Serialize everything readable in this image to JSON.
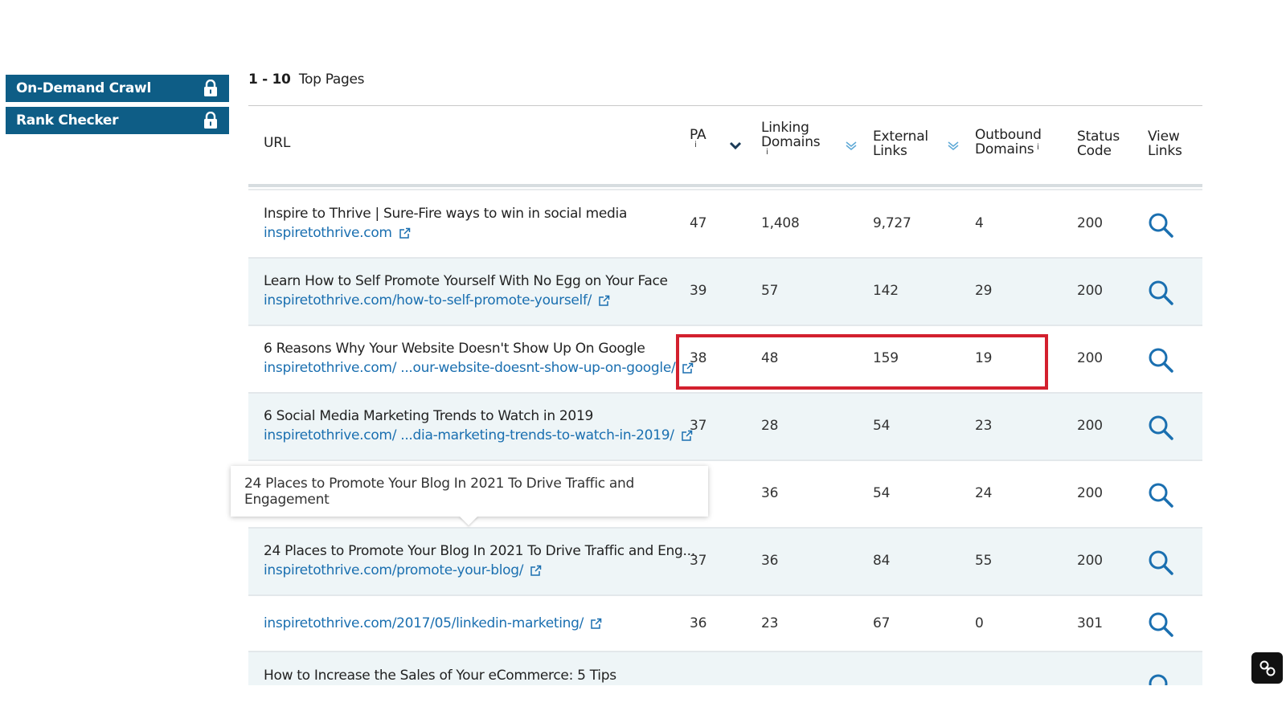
{
  "sidebar": {
    "items": [
      {
        "label": "On-Demand Crawl",
        "icon": "lock-icon"
      },
      {
        "label": "Rank Checker",
        "icon": "lock-icon"
      }
    ]
  },
  "results": {
    "range": "1 - 10",
    "label": "Top Pages"
  },
  "table": {
    "columns": {
      "url": "URL",
      "pa": "PA",
      "pa_info": "i",
      "linking_domains_1": "Linking",
      "linking_domains_2": "Domains",
      "linking_info": "i",
      "external_links_1": "External",
      "external_links_2": "Links",
      "outbound_domains_1": "Outbound",
      "outbound_domains_2": "Domains",
      "outbound_info": "i",
      "status_code_1": "Status",
      "status_code_2": "Code",
      "view_links_1": "View",
      "view_links_2": "Links"
    },
    "rows": [
      {
        "title": "Inspire to Thrive | Sure-Fire ways to win in social media",
        "url": "inspiretothrive.com",
        "pa": "47",
        "ld": "1,408",
        "el": "9,727",
        "od": "4",
        "sc": "200"
      },
      {
        "title": "Learn How to Self Promote Yourself With No Egg on Your Face",
        "url": "inspiretothrive.com/how-to-self-promote-yourself/",
        "pa": "39",
        "ld": "57",
        "el": "142",
        "od": "29",
        "sc": "200"
      },
      {
        "title": "6 Reasons Why Your Website Doesn't Show Up On Google",
        "url": "inspiretothrive.com/ ...our-website-doesnt-show-up-on-google/",
        "pa": "38",
        "ld": "48",
        "el": "159",
        "od": "19",
        "sc": "200"
      },
      {
        "title": "6 Social Media Marketing Trends to Watch in 2019",
        "url": "inspiretothrive.com/ ...dia-marketing-trends-to-watch-in-2019/",
        "pa": "37",
        "ld": "28",
        "el": "54",
        "od": "23",
        "sc": "200"
      },
      {
        "title": "",
        "url": "",
        "pa": "",
        "ld": "36",
        "el": "54",
        "od": "24",
        "sc": "200"
      },
      {
        "title": "24 Places to Promote Your Blog In 2021 To Drive Traffic and Eng...",
        "url": "inspiretothrive.com/promote-your-blog/",
        "pa": "37",
        "ld": "36",
        "el": "84",
        "od": "55",
        "sc": "200"
      },
      {
        "title": "",
        "url": "inspiretothrive.com/2017/05/linkedin-marketing/",
        "pa": "36",
        "ld": "23",
        "el": "67",
        "od": "0",
        "sc": "301"
      }
    ],
    "partial_row_title": "How to Increase the Sales of Your eCommerce: 5 Tips"
  },
  "tooltip": {
    "text": "24 Places to Promote Your Blog In 2021 To Drive Traffic and Engagement"
  },
  "colors": {
    "sidebar_bg": "#0e5d86",
    "link": "#1a6fb0",
    "highlight": "#d3202e",
    "row_alt": "#eef5f7"
  }
}
